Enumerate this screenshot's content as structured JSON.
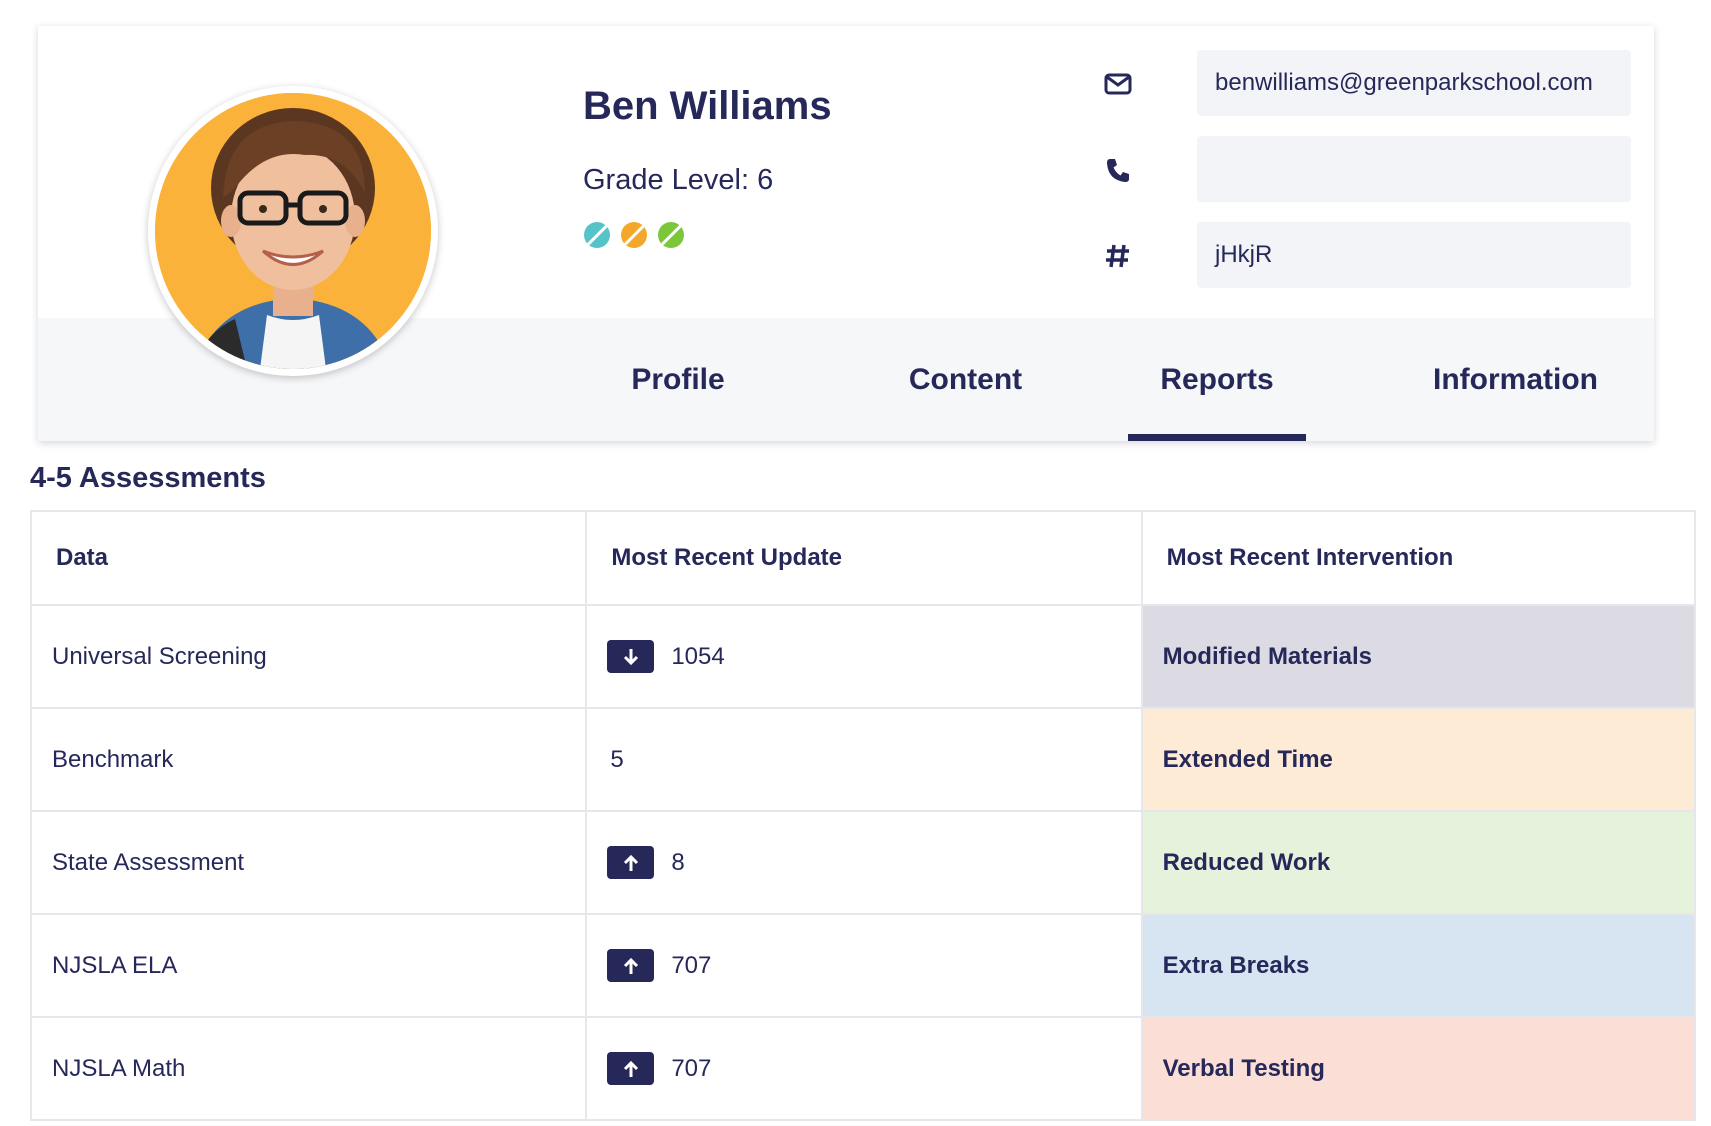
{
  "student": {
    "name": "Ben Williams",
    "grade_level": "Grade Level: 6",
    "status_dots": [
      "teal",
      "orange",
      "green"
    ]
  },
  "contact": {
    "email": "benwilliams@greenparkschool.com",
    "phone": "",
    "id_code": "jHkjR",
    "icons": [
      "envelope-icon",
      "phone-icon",
      "hash-icon"
    ]
  },
  "tabs": [
    {
      "label": "Profile",
      "active": false
    },
    {
      "label": "Content",
      "active": false
    },
    {
      "label": "Reports",
      "active": true
    },
    {
      "label": "Information",
      "active": false
    }
  ],
  "section": {
    "title": "4-5 Assessments"
  },
  "table": {
    "headers": [
      "Data",
      "Most Recent Update",
      "Most Recent Intervention"
    ],
    "rows": [
      {
        "data": "Universal Screening",
        "trend": "down",
        "value": "1054",
        "intervention": "Modified Materials",
        "color": "#dcdbe4"
      },
      {
        "data": "Benchmark",
        "trend": "none",
        "value": "5",
        "intervention": "Extended Time",
        "color": "#fdebd6"
      },
      {
        "data": "State Assessment",
        "trend": "up",
        "value": "8",
        "intervention": "Reduced Work",
        "color": "#e5f3dc"
      },
      {
        "data": "NJSLA ELA",
        "trend": "up",
        "value": "707",
        "intervention": "Extra Breaks",
        "color": "#d7e4f1"
      },
      {
        "data": "NJSLA Math",
        "trend": "up",
        "value": "707",
        "intervention": "Verbal Testing",
        "color": "#fbded5"
      }
    ]
  },
  "colors": {
    "primary": "#26285a",
    "avatar_bg": "#fbb23a",
    "dot_teal": "#56c3c9",
    "dot_orange": "#f4a82b",
    "dot_green": "#7cc63a"
  }
}
